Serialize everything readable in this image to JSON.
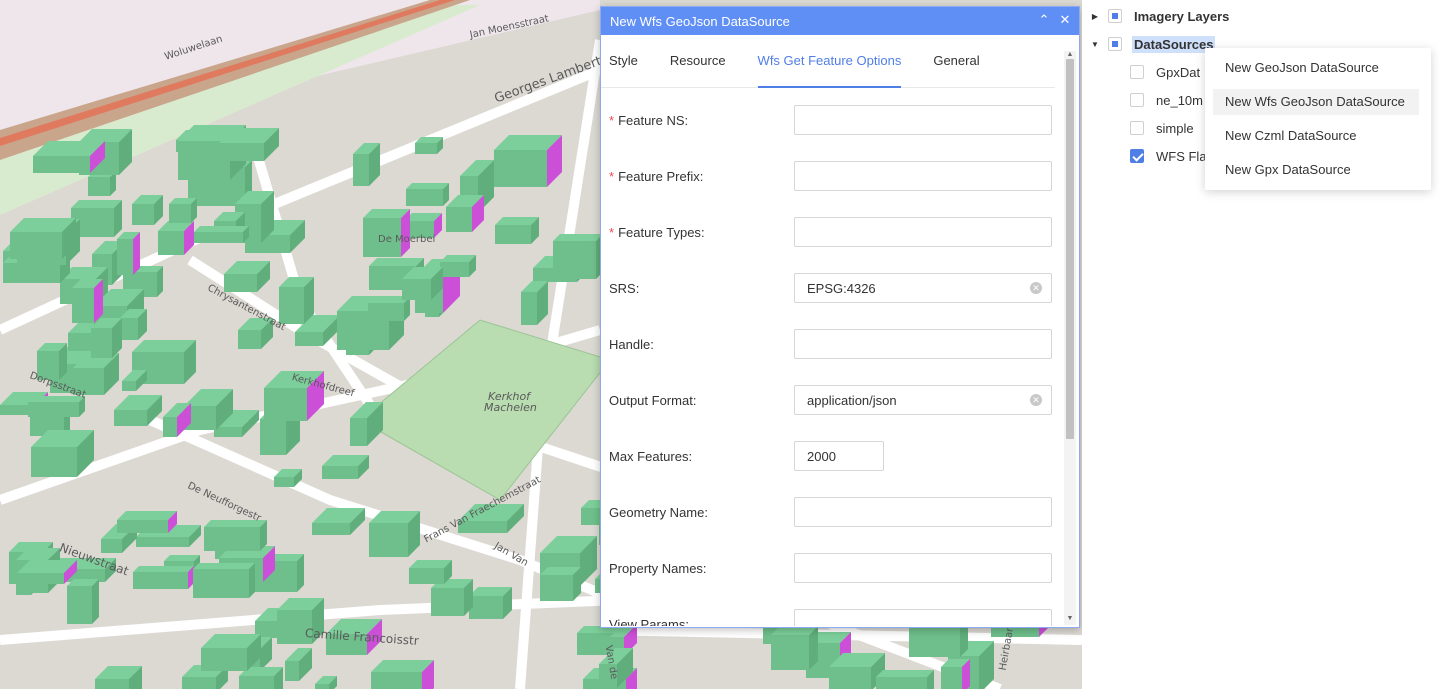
{
  "map": {
    "labels": [
      "Woluwelaan",
      "Jan Moensstraat",
      "Georges Lambertel",
      "De Moerbei",
      "Chrysantenstraat",
      "Kerkhofdreef",
      "Kerkhof",
      "Machelen",
      "De Neufforgestr",
      "Frans Van Fraechemstraat",
      "Nieuwstraat",
      "Camille Francoisstr",
      "Van de",
      "Heirbaan",
      "Jan Van",
      "Dorpsstraat"
    ]
  },
  "dialog": {
    "title": "New Wfs GeoJson DataSource",
    "tabs": [
      "Style",
      "Resource",
      "Wfs Get Feature Options",
      "General"
    ],
    "active_tab": "Wfs Get Feature Options",
    "fields": {
      "feature_ns": {
        "label": "Feature NS",
        "required": true,
        "value": "",
        "colon": ":"
      },
      "feature_prefix": {
        "label": "Feature Prefix",
        "required": true,
        "value": "",
        "colon": ":"
      },
      "feature_types": {
        "label": "Feature Types",
        "required": true,
        "value": "",
        "colon": ":"
      },
      "srs": {
        "label": "SRS",
        "required": false,
        "value": "EPSG:4326",
        "colon": ":"
      },
      "handle": {
        "label": "Handle",
        "required": false,
        "value": "",
        "colon": ":"
      },
      "output_format": {
        "label": "Output Format",
        "required": false,
        "value": "application/json",
        "colon": ":"
      },
      "max_features": {
        "label": "Max Features",
        "required": false,
        "value": "2000",
        "colon": ":"
      },
      "geometry_name": {
        "label": "Geometry Name",
        "required": false,
        "value": "",
        "colon": ":"
      },
      "property_names": {
        "label": "Property Names",
        "required": false,
        "value": "",
        "colon": ":"
      },
      "view_params": {
        "label": "View Params",
        "required": false,
        "value": "",
        "colon": ":"
      }
    },
    "required_marker": "*"
  },
  "tree": {
    "imagery": {
      "label": "Imagery Layers",
      "expanded": false,
      "state": "partial"
    },
    "datasources": {
      "label": "DataSources",
      "expanded": true,
      "state": "partial",
      "children": [
        {
          "label": "GpxDat",
          "checked": false
        },
        {
          "label": "ne_10m",
          "checked": false
        },
        {
          "label": "simple",
          "checked": false
        },
        {
          "label": "WFS Fla",
          "checked": true
        }
      ]
    }
  },
  "context_menu": {
    "items": [
      "New GeoJson DataSource",
      "New Wfs GeoJson DataSource",
      "New Czml DataSource",
      "New Gpx DataSource"
    ],
    "hovered": "New Wfs GeoJson DataSource"
  },
  "colors": {
    "accent": "#4f7ee6",
    "header": "#5f8ff5",
    "building": "#7ccf9a",
    "building_side": "#cc4fd8",
    "park": "#b9dcb0"
  }
}
